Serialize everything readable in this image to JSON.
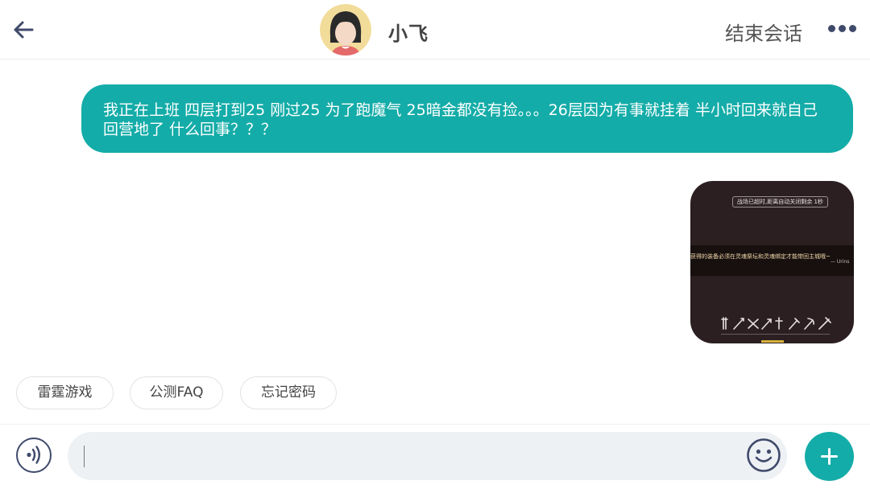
{
  "header": {
    "agent_name": "小飞",
    "end_chat_label": "结束会话",
    "back_icon": "arrow-left-icon",
    "more_icon": "more-dots-icon"
  },
  "messages": [
    {
      "type": "text",
      "side": "outgoing",
      "text": "我正在上班 四层打到25 刚过25 为了跑魔气 25暗金都没有捡。。。26层因为有事就挂着 半小时回来就自己回营地了 什么回事？？？"
    },
    {
      "type": "image",
      "side": "outgoing",
      "notice": "战场已超时,距离自动关闭剩余 1秒",
      "hint": "获得的装备必须在灵魂祭坛和灵魂绑定才能带回主城哦~",
      "signature": "— Urins"
    }
  ],
  "quick_replies": [
    "雷霆游戏",
    "公测FAQ",
    "忘记密码"
  ],
  "input": {
    "value": "",
    "voice_icon": "voice-icon",
    "emoji_icon": "emoji-icon",
    "add_icon": "plus-icon"
  },
  "colors": {
    "accent": "#14aca8",
    "icon": "#3f4a6b",
    "input_bg": "#eef1f4"
  }
}
